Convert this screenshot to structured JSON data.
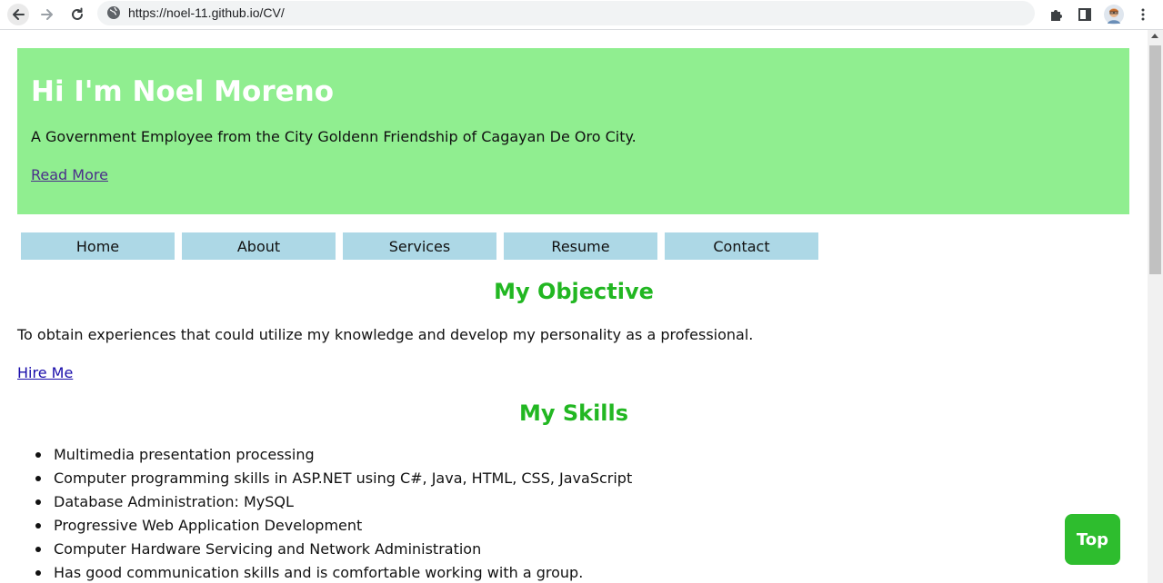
{
  "browser": {
    "url": "https://noel-11.github.io/CV/"
  },
  "hero": {
    "heading": "Hi I'm Noel Moreno",
    "tagline": "A Government Employee from the City Goldenn Friendship of Cagayan De Oro City.",
    "read_more": "Read More",
    "background_color": "#90ee90"
  },
  "nav": {
    "items": [
      {
        "label": "Home"
      },
      {
        "label": "About"
      },
      {
        "label": "Services"
      },
      {
        "label": "Resume"
      },
      {
        "label": "Contact"
      }
    ],
    "background_color": "#add8e6"
  },
  "objective": {
    "title": "My Objective",
    "text": "To obtain experiences that could utilize my knowledge and develop my personality as a professional.",
    "link": "Hire Me"
  },
  "skills": {
    "title": "My Skills",
    "items": [
      "Multimedia presentation processing",
      "Computer programming skills in ASP.NET using C#, Java, HTML, CSS, JavaScript",
      "Database Administration: MySQL",
      "Progressive Web Application Development",
      "Computer Hardware Servicing and Network Administration",
      "Has good communication skills and is comfortable working with a group."
    ]
  },
  "top_button": {
    "label": "Top",
    "color": "#2ebd2e"
  },
  "accent_color": "#22b722"
}
